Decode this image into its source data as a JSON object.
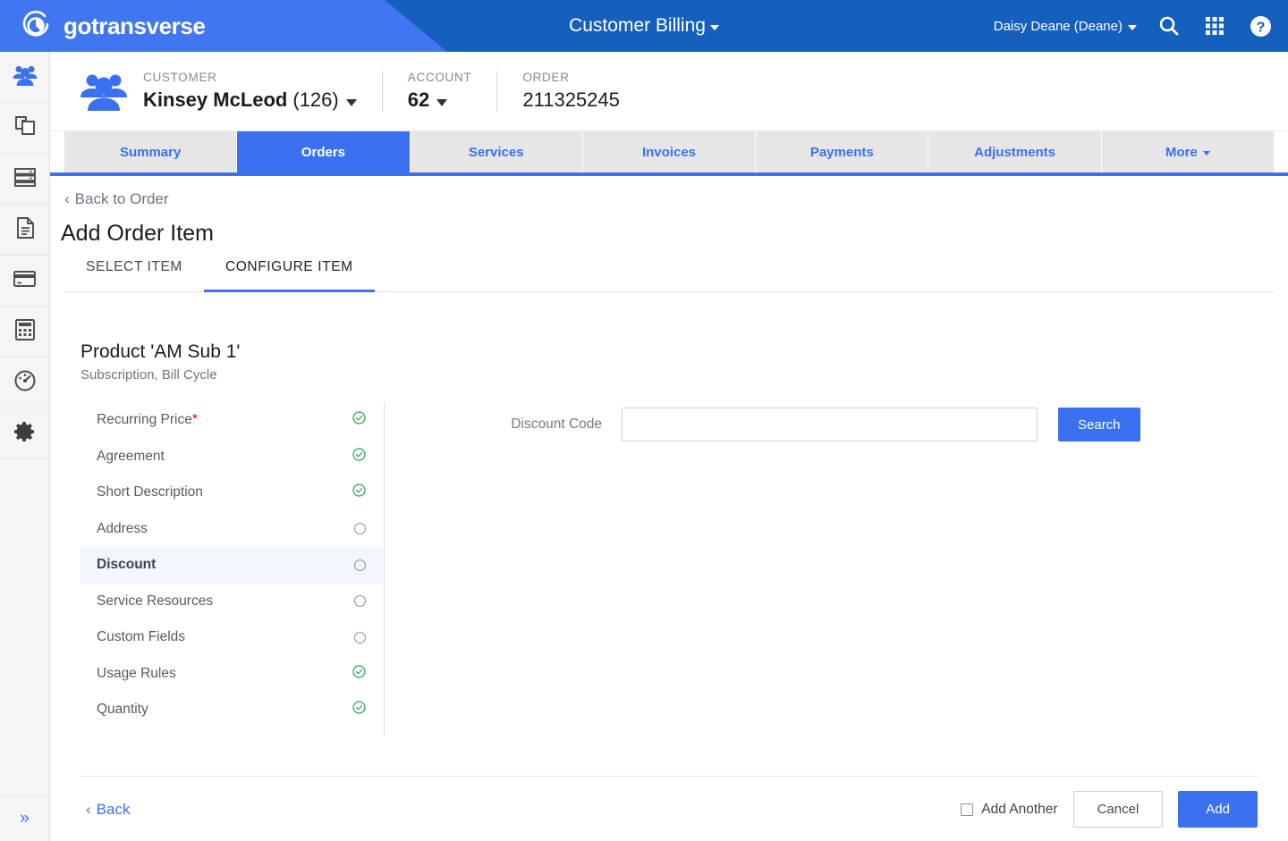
{
  "header": {
    "logo_text": "gotransverse",
    "logo_icon": "circle-swirl-logo-icon",
    "app_title": "Customer Billing",
    "user_name": "Daisy Deane (Deane)",
    "search_icon": "search-icon",
    "apps_icon": "apps-grid-icon",
    "help_icon": "help-circle-icon",
    "colors": {
      "light_blue": "#4076F0",
      "dark_blue": "#1560BD"
    }
  },
  "sidebar": {
    "items": [
      {
        "icon": "users-group-icon",
        "active": true
      },
      {
        "icon": "copy-documents-icon",
        "active": false
      },
      {
        "icon": "server-stack-icon",
        "active": false
      },
      {
        "icon": "document-page-icon",
        "active": false
      },
      {
        "icon": "credit-card-icon",
        "active": false
      },
      {
        "icon": "calculator-icon",
        "active": false
      },
      {
        "icon": "gauge-meter-icon",
        "active": false
      },
      {
        "icon": "gear-settings-icon",
        "active": false
      }
    ],
    "expand_icon": "double-chevron-right-icon"
  },
  "breadcrumb": {
    "icon": "customer-group-icon",
    "customer": {
      "label": "CUSTOMER",
      "name": "Kinsey McLeod",
      "id": "(126)"
    },
    "account": {
      "label": "ACCOUNT",
      "value": "62"
    },
    "order": {
      "label": "ORDER",
      "value": "211325245"
    }
  },
  "tabs": [
    {
      "label": "Summary",
      "active": false
    },
    {
      "label": "Orders",
      "active": true
    },
    {
      "label": "Services",
      "active": false
    },
    {
      "label": "Invoices",
      "active": false
    },
    {
      "label": "Payments",
      "active": false
    },
    {
      "label": "Adjustments",
      "active": false
    },
    {
      "label": "More",
      "active": false,
      "has_caret": true
    }
  ],
  "page": {
    "back_to_order": "Back to Order",
    "title": "Add Order Item",
    "subtabs": [
      {
        "label": "SELECT ITEM",
        "active": false
      },
      {
        "label": "CONFIGURE ITEM",
        "active": true
      }
    ],
    "product_name": "Product 'AM Sub 1'",
    "product_sub": "Subscription, Bill Cycle"
  },
  "steps": [
    {
      "label": "Recurring Price",
      "required": true,
      "status": "done",
      "selected": false
    },
    {
      "label": "Agreement",
      "required": false,
      "status": "done",
      "selected": false
    },
    {
      "label": "Short Description",
      "required": false,
      "status": "done",
      "selected": false
    },
    {
      "label": "Address",
      "required": false,
      "status": "pending",
      "selected": false
    },
    {
      "label": "Discount",
      "required": false,
      "status": "pending",
      "selected": true
    },
    {
      "label": "Service Resources",
      "required": false,
      "status": "pending",
      "selected": false
    },
    {
      "label": "Custom Fields",
      "required": false,
      "status": "pending",
      "selected": false
    },
    {
      "label": "Usage Rules",
      "required": false,
      "status": "done",
      "selected": false
    },
    {
      "label": "Quantity",
      "required": false,
      "status": "done",
      "selected": false
    }
  ],
  "form": {
    "discount_code_label": "Discount Code",
    "discount_code_value": "",
    "discount_code_placeholder": "",
    "search_button": "Search"
  },
  "footer": {
    "back_label": "Back",
    "add_another_label": "Add Another",
    "add_another_checked": false,
    "cancel_label": "Cancel",
    "add_label": "Add"
  }
}
